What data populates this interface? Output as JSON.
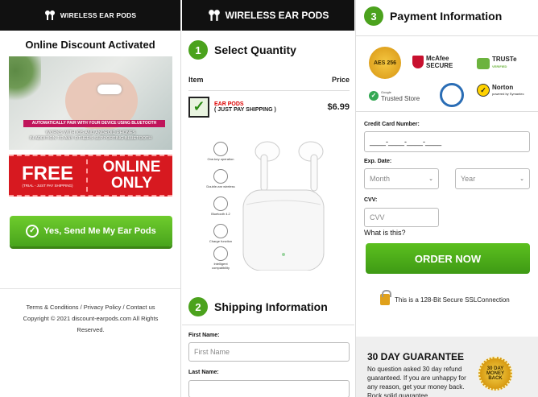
{
  "brand": {
    "name": "WIRELESS EAR PODS"
  },
  "left": {
    "discount_title": "Online Discount Activated",
    "hero_band": "AUTOMATICALLY PAIR WITH YOUR DEVICE USING BLUETOOTH",
    "hero_sub1": "WORKS WITH IOS AND ANDROID PHONES",
    "hero_sub2": "IN ADDITION TO ANY OTHERS SUPPORTING BLUETOOTH",
    "promo_free": "FREE",
    "promo_free_sub": "(TRIAL - JUST PAY SHIPPING)",
    "promo_online": "ONLINE",
    "promo_only": "ONLY",
    "cta_label": "Yes, Send Me My Ear Pods",
    "footer_links": "Terms & Conditions / Privacy Policy / Contact us",
    "footer_copy1": "Copyright © 2021 discount-earpods.com All Rights",
    "footer_copy2": "Reserved."
  },
  "middle": {
    "step1_num": "1",
    "step1_title": "Select Quantity",
    "col_item": "Item",
    "col_price": "Price",
    "item_name": "EAR PODS",
    "item_sub": "( JUST PAY SHIPPING )",
    "item_price": "$6.99",
    "features": [
      "One-key operation",
      "Double-ear wireless",
      "Bluetooth 4.2",
      "Charge function",
      "Intelligent compatibility"
    ],
    "step2_num": "2",
    "step2_title": "Shipping Information",
    "first_name_label": "First Name:",
    "first_name_placeholder": "First Name",
    "last_name_label": "Last Name:"
  },
  "right": {
    "step3_num": "3",
    "step3_title": "Payment Information",
    "badges": {
      "aes": "AES 256",
      "mcafee": "McAfee SECURE",
      "truste": "TRUSTe",
      "truste_sub": "VERIFIED",
      "trusted_store": "Trusted Store",
      "trusted_store_pre": "Google",
      "norton": "Norton",
      "norton_sub": "powered by Symantec"
    },
    "cc_label": "Credit Card Number:",
    "cc_value": "____-____-____-____",
    "exp_label": "Exp. Date:",
    "month": "Month",
    "year": "Year",
    "cvv_label": "CVV:",
    "cvv_placeholder": "CVV",
    "cvv_help": "What is this?",
    "order_button": "ORDER NOW",
    "ssl_text": "This is a 128-Bit Secure SSLConnection",
    "guarantee_title": "30 DAY GUARANTEE",
    "guarantee_text": "No question asked 30 day refund guaranteed. If you are unhappy for any reason, get your money back. Rock solid guarantee.",
    "seal_text": "30 DAY MONEY BACK"
  },
  "colors": {
    "accent_green": "#4ba21d",
    "promo_red": "#d71920",
    "header_black": "#111111"
  }
}
